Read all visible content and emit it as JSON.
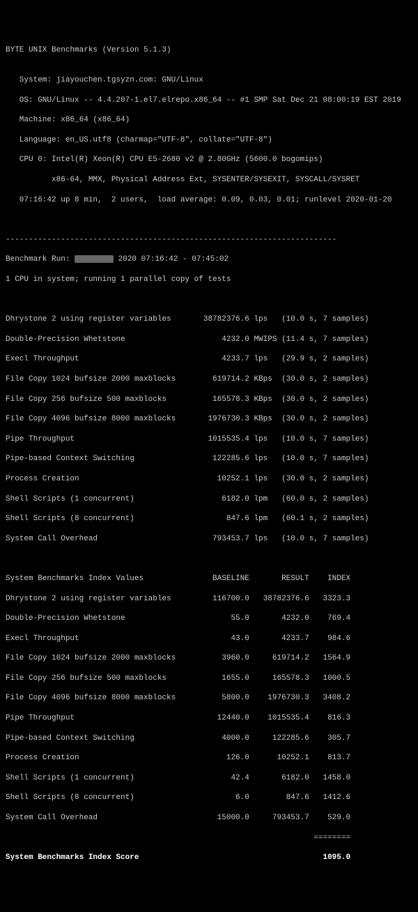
{
  "header": {
    "title": "BYTE UNIX Benchmarks (Version 5.1.3)",
    "blank1": "",
    "system": "   System: jiayouchen.tgsyzn.com: GNU/Linux",
    "os": "   OS: GNU/Linux -- 4.4.207-1.el7.elrepo.x86_64 -- #1 SMP Sat Dec 21 08:00:19 EST 2019",
    "machine": "   Machine: x86_64 (x86_64)",
    "language": "   Language: en_US.utf8 (charmap=\"UTF-8\", collate=\"UTF-8\")",
    "cpu0": "   CPU 0: Intel(R) Xeon(R) CPU E5-2680 v2 @ 2.80GHz (5600.0 bogomips)",
    "cpu0b": "          x86-64, MMX, Physical Address Ext, SYSENTER/SYSEXIT, SYSCALL/SYSRET",
    "uptime": "   07:16:42 up 8 min,  2 users,  load average: 0.09, 0.03, 0.01; runlevel 2020-01-20"
  },
  "separator": "------------------------------------------------------------------------",
  "run": {
    "label_before": "Benchmark Run: ",
    "label_after": " 2020 07:16:42 - 07:45:02",
    "cpuline": "1 CPU in system; running 1 parallel copy of tests"
  },
  "results": [
    "Dhrystone 2 using register variables       38782376.6 lps   (10.0 s, 7 samples)",
    "Double-Precision Whetstone                     4232.0 MWIPS (11.4 s, 7 samples)",
    "Execl Throughput                               4233.7 lps   (29.9 s, 2 samples)",
    "File Copy 1024 bufsize 2000 maxblocks        619714.2 KBps  (30.0 s, 2 samples)",
    "File Copy 256 bufsize 500 maxblocks          165578.3 KBps  (30.0 s, 2 samples)",
    "File Copy 4096 bufsize 8000 maxblocks       1976730.3 KBps  (30.0 s, 2 samples)",
    "Pipe Throughput                             1015535.4 lps   (10.0 s, 7 samples)",
    "Pipe-based Context Switching                 122285.6 lps   (10.0 s, 7 samples)",
    "Process Creation                              10252.1 lps   (30.0 s, 2 samples)",
    "Shell Scripts (1 concurrent)                   6182.0 lpm   (60.0 s, 2 samples)",
    "Shell Scripts (8 concurrent)                    847.6 lpm   (60.1 s, 2 samples)",
    "System Call Overhead                         793453.7 lps   (10.0 s, 7 samples)"
  ],
  "index_header": "System Benchmarks Index Values               BASELINE       RESULT    INDEX",
  "index": [
    "Dhrystone 2 using register variables         116700.0   38782376.6   3323.3",
    "Double-Precision Whetstone                       55.0       4232.0    769.4",
    "Execl Throughput                                 43.0       4233.7    984.6",
    "File Copy 1024 bufsize 2000 maxblocks          3960.0     619714.2   1564.9",
    "File Copy 256 bufsize 500 maxblocks            1655.0     165578.3   1000.5",
    "File Copy 4096 bufsize 8000 maxblocks          5800.0    1976730.3   3408.2",
    "Pipe Throughput                               12440.0    1015535.4    816.3",
    "Pipe-based Context Switching                   4000.0     122285.6    305.7",
    "Process Creation                                126.0      10252.1    813.7",
    "Shell Scripts (1 concurrent)                     42.4       6182.0   1458.0",
    "Shell Scripts (8 concurrent)                      6.0        847.6   1412.6",
    "System Call Overhead                          15000.0     793453.7    529.0"
  ],
  "index_sep": "                                                                   ========",
  "score_line": "System Benchmarks Index Score                                        1095.0"
}
